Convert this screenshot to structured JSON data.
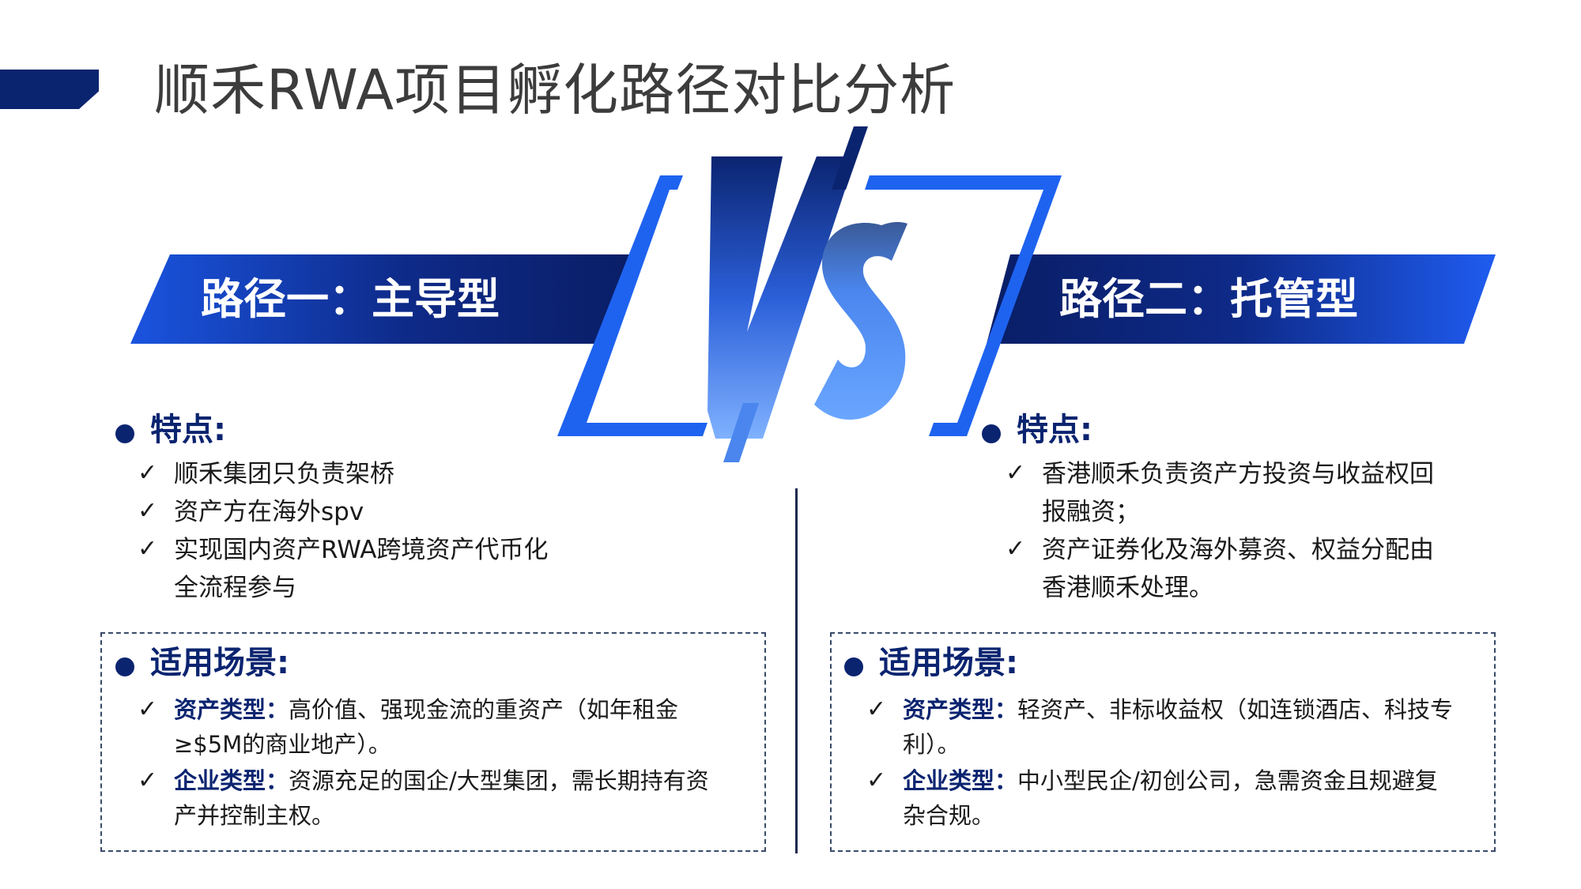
{
  "page": {
    "title": "顺禾RWA项目孵化路径对比分析"
  },
  "colors": {
    "navy": "#0b2470",
    "blue": "#1e63f0",
    "light_blue": "#6aa6ff"
  },
  "left": {
    "title": "路径一：主导型",
    "features_heading": "特点:",
    "features": [
      "顺禾集团只负责架桥",
      "资产方在海外spv",
      "实现国内资产RWA跨境资产代币化",
      "全流程参与"
    ],
    "scenarios_heading": "适用场景:",
    "scenarios": [
      {
        "label": "资产类型：",
        "text_line1": "高价值、强现金流的重资产（如年租金",
        "text_line2": "≥$5M的商业地产）。"
      },
      {
        "label": "企业类型：",
        "text_line1": "资源充足的国企/大型集团，需长期持有资",
        "text_line2": "产并控制主权。"
      }
    ]
  },
  "right": {
    "title": "路径二：托管型",
    "features_heading": "特点:",
    "features": [
      "香港顺禾负责资产方投资与收益权回",
      "报融资；",
      "资产证券化及海外募资、权益分配由",
      "香港顺禾处理。"
    ],
    "scenarios_heading": "适用场景:",
    "scenarios": [
      {
        "label": "资产类型：",
        "text_line1": "轻资产、非标收益权（如连锁酒店、科技专",
        "text_line2": "利）。"
      },
      {
        "label": "企业类型：",
        "text_line1": "中小型民企/初创公司，急需资金且规避复",
        "text_line2": "杂合规。"
      }
    ]
  },
  "check_icon": "✓"
}
